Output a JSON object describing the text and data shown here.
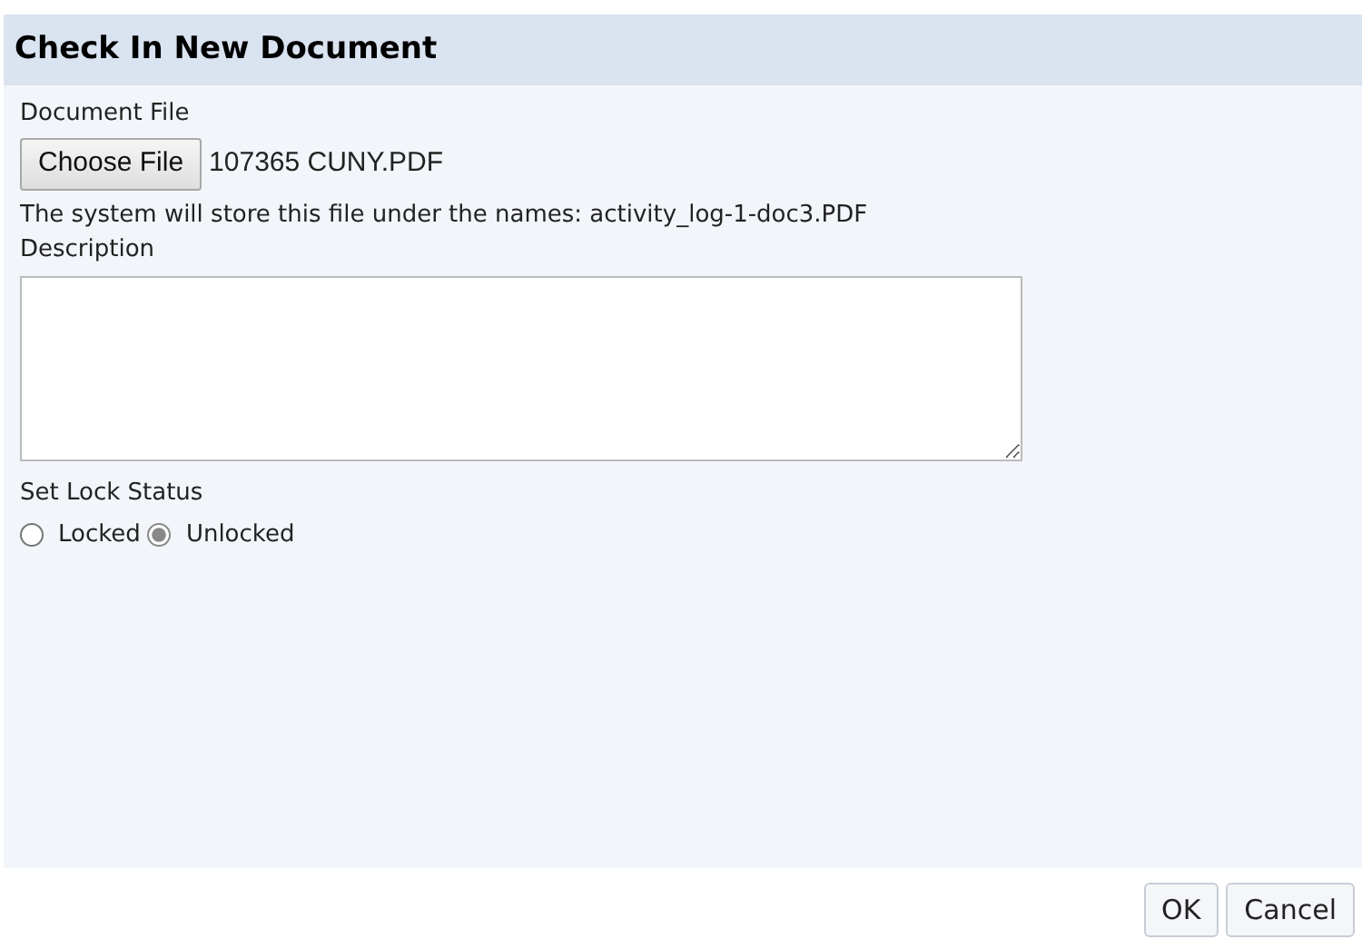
{
  "title": "Check In New Document",
  "file": {
    "label": "Document File",
    "button": "Choose File",
    "filename": "107365 CUNY.PDF"
  },
  "note": "The system will store this file under the names: activity_log-1-doc3.PDF",
  "description": {
    "label": "Description"
  },
  "lock": {
    "label": "Set Lock Status",
    "options": [
      {
        "label": "Locked",
        "selected": false
      },
      {
        "label": "Unlocked",
        "selected": true
      }
    ]
  },
  "buttons": [
    "OK",
    "Cancel"
  ]
}
